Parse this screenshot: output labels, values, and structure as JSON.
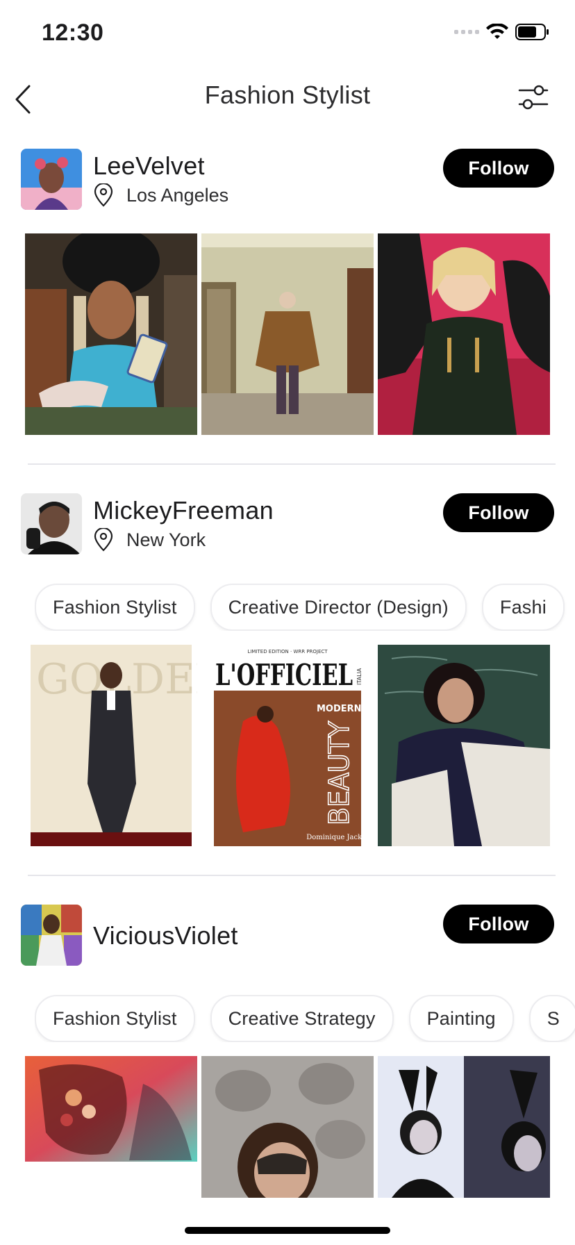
{
  "status_bar": {
    "time": "12:30"
  },
  "nav": {
    "title": "Fashion Stylist",
    "icons": [
      "back-icon",
      "filter-sliders-icon"
    ]
  },
  "profiles": [
    {
      "name": "LeeVelvet",
      "location": "Los Angeles",
      "follow_label": "Follow",
      "tags": [],
      "photos": [
        "portrait-blue-top-braids",
        "room-brown-cape",
        "red-backdrop-portrait"
      ]
    },
    {
      "name": "MickeyFreeman",
      "location": "New York",
      "follow_label": "Follow",
      "tags": [
        "Fashion Stylist",
        "Creative Director (Design)",
        "Fashi"
      ],
      "photos": [
        "golden-globes-suit",
        "lofficiel-magazine-cover",
        "chalkboard-coat-portrait"
      ],
      "photo_texts": {
        "cover_header": "LIMITED EDITION · WRR PROJECT",
        "cover_masthead": "L'OFFICIEL",
        "cover_side": "ITALIA",
        "cover_modern": "MODERN",
        "cover_beauty": "BEAUTY",
        "cover_name": "Dominique Jackson",
        "backdrop_text": "GOLDEN GLOBES"
      }
    },
    {
      "name": "ViciousViolet",
      "location": "",
      "follow_label": "Follow",
      "tags": [
        "Fashion Stylist",
        "Creative Strategy",
        "Painting",
        "S"
      ],
      "photos": [
        "red-teal-flowers",
        "lace-mask-portrait",
        "bunny-ears-bw"
      ]
    }
  ],
  "colors": {
    "follow_bg": "#000000",
    "follow_text": "#ffffff",
    "divider": "#e5e5ea",
    "tag_border": "#ececef"
  }
}
